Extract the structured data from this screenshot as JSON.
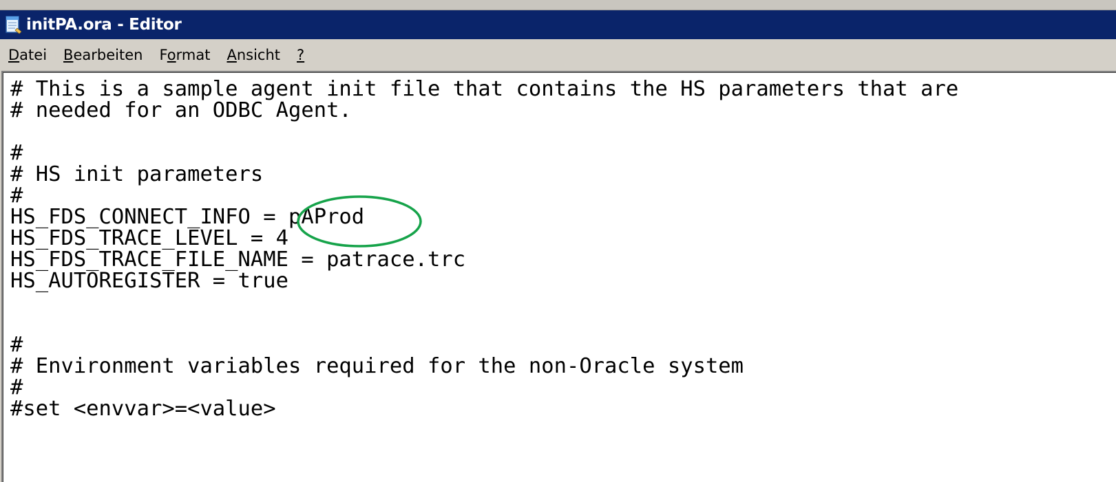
{
  "window": {
    "title": "initPA.ora - Editor",
    "titlebar_color": "#0a246a",
    "icon": "notepad-icon"
  },
  "menu": {
    "items": [
      {
        "pre": "",
        "acc": "D",
        "post": "atei"
      },
      {
        "pre": "",
        "acc": "B",
        "post": "earbeiten"
      },
      {
        "pre": "F",
        "acc": "o",
        "post": "rmat"
      },
      {
        "pre": "",
        "acc": "A",
        "post": "nsicht"
      },
      {
        "pre": "",
        "acc": "?",
        "post": ""
      }
    ]
  },
  "editor": {
    "lines": [
      "# This is a sample agent init file that contains the HS parameters that are",
      "# needed for an ODBC Agent.",
      "",
      "#",
      "# HS init parameters",
      "#",
      "HS_FDS_CONNECT_INFO = pAProd",
      "HS_FDS_TRACE_LEVEL = 4",
      "HS_FDS_TRACE_FILE_NAME = patrace.trc",
      "HS_AUTOREGISTER = true",
      "",
      "",
      "#",
      "# Environment variables required for the non-Oracle system",
      "#",
      "#set <envvar>=<value>"
    ],
    "annotation_color": "#16a34a"
  }
}
